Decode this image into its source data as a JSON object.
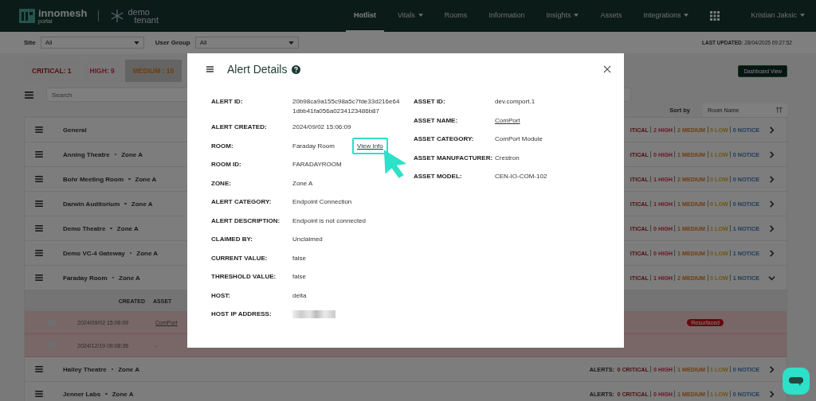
{
  "nav": {
    "brand": "innomesh",
    "brand_sub": "portal",
    "tenant_top": "demo",
    "tenant_bottom": "tenant",
    "items": [
      {
        "label": "Hotlist",
        "selected": true,
        "dropdown": false
      },
      {
        "label": "Vitals",
        "selected": false,
        "dropdown": true
      },
      {
        "label": "Rooms",
        "selected": false,
        "dropdown": false
      },
      {
        "label": "Information",
        "selected": false,
        "dropdown": false
      },
      {
        "label": "Insights",
        "selected": false,
        "dropdown": true
      },
      {
        "label": "Assets",
        "selected": false,
        "dropdown": false
      },
      {
        "label": "Integrations",
        "selected": false,
        "dropdown": true
      }
    ],
    "user": "Kristian Jaksic"
  },
  "filters": {
    "site_label": "Site",
    "site_value": "All",
    "group_label": "User Group",
    "group_value": "All",
    "last_updated": "**LAST UPDATED**: 28/04/2025 09:27:52"
  },
  "severity_tabs": [
    {
      "label": "CRITICAL: 1",
      "kind": "critical",
      "selected": false
    },
    {
      "label": "HIGH: 9",
      "kind": "high",
      "selected": false
    },
    {
      "label": "MEDIUM : 15",
      "kind": "medium",
      "selected": true
    }
  ],
  "search": {
    "placeholder": "Search"
  },
  "dashboard_button": "Dashboard View",
  "sort": {
    "label": "Sort by",
    "value": "Room Name"
  },
  "rooms": [
    {
      "name": "General",
      "expanded": false,
      "alerts": [
        {
          "kind": "critical",
          "text": "ITICAL"
        },
        {
          "kind": "high",
          "text": "2 HIGH"
        },
        {
          "kind": "medium",
          "text": "2 MEDIUM"
        },
        {
          "kind": "low",
          "text": "0 LOW"
        },
        {
          "kind": "notice",
          "text": "0 NOTICE"
        }
      ]
    },
    {
      "name": "Anning Theatre",
      "zone": "Zone A",
      "expanded": false,
      "alerts": [
        {
          "kind": "critical",
          "text": "ITICAL"
        },
        {
          "kind": "high",
          "text": "0 HIGH"
        },
        {
          "kind": "medium",
          "text": "1 MEDIUM"
        },
        {
          "kind": "low",
          "text": "1 LOW"
        },
        {
          "kind": "notice",
          "text": "0 NOTICE"
        }
      ]
    },
    {
      "name": "Bohr Meeting Room",
      "zone": "Zone A",
      "expanded": false,
      "alerts": [
        {
          "kind": "critical",
          "text": "ITICAL"
        },
        {
          "kind": "high",
          "text": "1 HIGH"
        },
        {
          "kind": "medium",
          "text": "2 MEDIUM"
        },
        {
          "kind": "low",
          "text": "0 LOW"
        },
        {
          "kind": "notice",
          "text": "0 NOTICE"
        }
      ]
    },
    {
      "name": "Darwin Auditorium",
      "zone": "Zone A",
      "expanded": false,
      "alerts": [
        {
          "kind": "critical",
          "text": "ITICAL"
        },
        {
          "kind": "high",
          "text": "1 HIGH"
        },
        {
          "kind": "medium",
          "text": "1 MEDIUM"
        },
        {
          "kind": "low",
          "text": "0 LOW"
        },
        {
          "kind": "notice",
          "text": "0 NOTICE"
        }
      ]
    },
    {
      "name": "Demo Theatre",
      "zone": "Zone A",
      "expanded": false,
      "alerts": [
        {
          "kind": "critical",
          "text": "ITICAL"
        },
        {
          "kind": "high",
          "text": "0 HIGH"
        },
        {
          "kind": "medium",
          "text": "1 MEDIUM"
        },
        {
          "kind": "low",
          "text": "1 LOW"
        },
        {
          "kind": "notice",
          "text": "1 NOTICE"
        }
      ]
    },
    {
      "name": "Demo VC-4 Gateway",
      "zone": "Zone A",
      "expanded": false,
      "alerts": [
        {
          "kind": "critical",
          "text": "ITICAL"
        },
        {
          "kind": "high",
          "text": "0 HIGH"
        },
        {
          "kind": "medium",
          "text": "1 MEDIUM"
        },
        {
          "kind": "low",
          "text": "0 LOW"
        },
        {
          "kind": "notice",
          "text": "1 NOTICE"
        }
      ]
    },
    {
      "name": "Faraday Room",
      "zone": "Zone A",
      "expanded": true,
      "alerts": [
        {
          "kind": "critical",
          "text": "ITICAL"
        },
        {
          "kind": "high",
          "text": "1 HIGH"
        },
        {
          "kind": "medium",
          "text": "2 MEDIUM"
        },
        {
          "kind": "low",
          "text": "0 LOW"
        },
        {
          "kind": "notice",
          "text": "1 NOTICE"
        }
      ],
      "detail": {
        "columns": [
          "CREATED",
          "ASSET"
        ],
        "rows": [
          {
            "checked": false,
            "created": "2024/09/02 15:06:09",
            "asset": "ComPort",
            "linked": true,
            "status": "Resurfaced"
          },
          {
            "checked": false,
            "created": "2024/12/19 09:08:36",
            "asset": "-",
            "linked": false
          }
        ]
      }
    },
    {
      "name": "Halley Theatre",
      "zone": "Zone A",
      "expanded": false,
      "alerts_label": "ALERTS:",
      "alerts": [
        {
          "kind": "critical",
          "text": "0 CRITICAL"
        },
        {
          "kind": "high",
          "text": "0 HIGH"
        },
        {
          "kind": "medium",
          "text": "1 MEDIUM"
        },
        {
          "kind": "low",
          "text": "1 LOW"
        },
        {
          "kind": "notice",
          "text": "0 NOTICE"
        }
      ]
    },
    {
      "name": "Jenner Labs",
      "zone": "Zone A",
      "expanded": false,
      "alerts_label": "ALERTS:",
      "alerts": [
        {
          "kind": "critical",
          "text": "0 CRITICAL"
        },
        {
          "kind": "high",
          "text": "0 HIGH"
        },
        {
          "kind": "medium",
          "text": "1 MEDIUM"
        },
        {
          "kind": "low",
          "text": "1 LOW"
        },
        {
          "kind": "notice",
          "text": "0 NOTICE"
        }
      ]
    }
  ],
  "modal": {
    "title": "Alert Details",
    "left_fields": [
      {
        "label": "ALERT ID:",
        "value": "20b98ca9a155c98a5c7fde33d216e641dbb41fa056a0234123486b87",
        "kind": "text"
      },
      {
        "label": "ALERT CREATED:",
        "value": "2024/09/02 15:06:09",
        "kind": "text"
      },
      {
        "label": "ROOM:",
        "value": "Faraday Room",
        "kind": "text",
        "action": "View Info"
      },
      {
        "label": "ROOM ID:",
        "value": "FARADAYROOM",
        "kind": "text"
      },
      {
        "label": "ZONE:",
        "value": "Zone A",
        "kind": "text"
      },
      {
        "label": "ALERT CATEGORY:",
        "value": "Endpoint Connection",
        "kind": "text"
      },
      {
        "label": "ALERT DESCRIPTION:",
        "value": "Endpoint is not connected",
        "kind": "text"
      },
      {
        "label": "CLAIMED BY:",
        "value": "Unclaimed",
        "kind": "text"
      },
      {
        "label": "CURRENT VALUE:",
        "value": "false",
        "kind": "text"
      },
      {
        "label": "THRESHOLD VALUE:",
        "value": "false",
        "kind": "text"
      },
      {
        "label": "HOST:",
        "value": "delta",
        "kind": "text"
      },
      {
        "label": "HOST IP ADDRESS:",
        "kind": "redacted"
      }
    ],
    "right_fields": [
      {
        "label": "ASSET ID:",
        "value": "dev.comport.1",
        "kind": "text"
      },
      {
        "label": "ASSET NAME:",
        "value": "ComPort",
        "kind": "link"
      },
      {
        "label": "ASSET CATEGORY:",
        "value": "ComPort Module",
        "kind": "text"
      },
      {
        "label": "ASSET MANUFACTURER:",
        "value": "Crestron",
        "kind": "text"
      },
      {
        "label": "ASSET MODEL:",
        "value": "CEN-IO-COM-102",
        "kind": "text"
      }
    ]
  }
}
